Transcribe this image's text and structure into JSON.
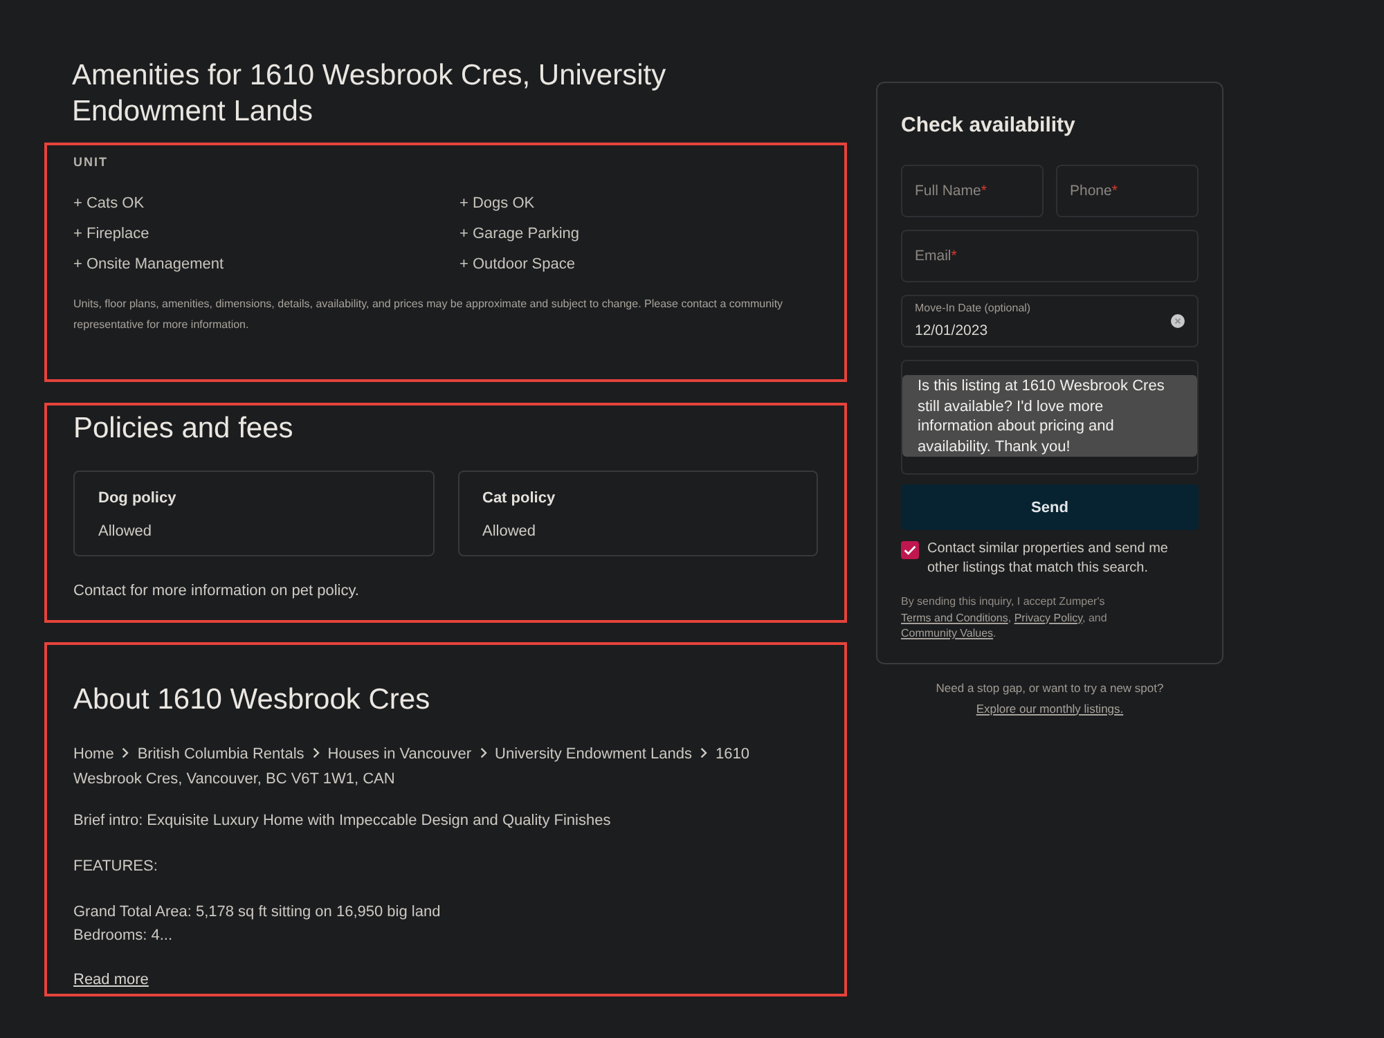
{
  "page": {
    "title": "Amenities for 1610 Wesbrook Cres, University Endowment Lands"
  },
  "amenities": {
    "heading": "UNIT",
    "items": [
      "+ Cats OK",
      "+ Dogs OK",
      "+ Fireplace",
      "+ Garage Parking",
      "+ Onsite Management",
      "+ Outdoor Space"
    ],
    "disclaimer": "Units, floor plans, amenities, dimensions, details, availability, and prices may be approximate and subject to change. Please contact a community representative for more information."
  },
  "policies": {
    "heading": "Policies and fees",
    "cards": [
      {
        "title": "Dog policy",
        "value": "Allowed"
      },
      {
        "title": "Cat policy",
        "value": "Allowed"
      }
    ],
    "note": "Contact for more information on pet policy."
  },
  "about": {
    "heading": "About 1610 Wesbrook Cres",
    "breadcrumbs": [
      "Home",
      "British Columbia Rentals",
      "Houses in Vancouver",
      "University Endowment Lands",
      "1610 Wesbrook Cres, Vancouver, BC V6T 1W1, CAN"
    ],
    "description": [
      [
        "Brief intro: Exquisite Luxury Home with Impeccable Design and Quality Finishes"
      ],
      [
        "FEATURES:"
      ],
      [
        "Grand Total Area: 5,178 sq ft sitting on 16,950 big land",
        "Bedrooms: 4..."
      ]
    ],
    "read_more": "Read more"
  },
  "form": {
    "title": "Check availability",
    "rows": [
      [
        {
          "kind": "text",
          "label": "Full Name",
          "required_mark": "*"
        },
        {
          "kind": "text",
          "label": "Phone",
          "required_mark": "*"
        }
      ],
      [
        {
          "kind": "text",
          "label": "Email",
          "required_mark": "*"
        }
      ],
      [
        {
          "kind": "date",
          "label": "Move-In Date (optional)",
          "value": "12/01/2023"
        }
      ],
      [
        {
          "kind": "textarea",
          "value": "Is this listing at 1610 Wesbrook Cres still available? I'd love more information about pricing and availability. Thank you!",
          "highlighted": true
        }
      ]
    ],
    "submit": "Send",
    "opt_in": {
      "label": "Contact similar properties and send me other listings that match this search.",
      "checked": true
    },
    "legal": [
      {
        "kind": "text",
        "text": "By sending this inquiry, I accept Zumper's "
      },
      {
        "kind": "link",
        "text": "Terms and Conditions"
      },
      {
        "kind": "text",
        "text": ", "
      },
      {
        "kind": "link",
        "text": "Privacy Policy"
      },
      {
        "kind": "text",
        "text": ", and "
      },
      {
        "kind": "link",
        "text": "Community Values"
      },
      {
        "kind": "text",
        "text": "."
      }
    ]
  },
  "footer": {
    "text": "Need a stop gap, or want to try a new spot?",
    "link": "Explore our monthly listings."
  }
}
